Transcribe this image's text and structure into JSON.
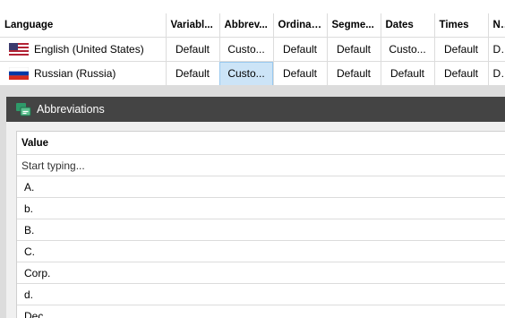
{
  "grid": {
    "columns": [
      "Language",
      "Variabl...",
      "Abbrev...",
      "Ordinal...",
      "Segme...",
      "Dates",
      "Times",
      "Nu"
    ],
    "rows": [
      {
        "language": "English (United States)",
        "flag": "us-flag-icon",
        "cells": [
          "Default",
          "Custo...",
          "Default",
          "Default",
          "Custo...",
          "Default",
          "D"
        ]
      },
      {
        "language": "Russian (Russia)",
        "flag": "russia-flag-icon",
        "cells": [
          "Default",
          "Custo...",
          "Default",
          "Default",
          "Default",
          "Default",
          "D"
        ],
        "selected_cell": 1
      }
    ]
  },
  "dialog": {
    "title": "Abbreviations",
    "icon": "abbreviations-app-icon",
    "column_header": "Value",
    "input_placeholder": "Start typing...",
    "values": [
      "A.",
      "b.",
      "B.",
      "C.",
      "Corp.",
      "d.",
      "Dec."
    ]
  },
  "colors": {
    "selection": "#cce4f7",
    "titlebar": "#444444"
  }
}
